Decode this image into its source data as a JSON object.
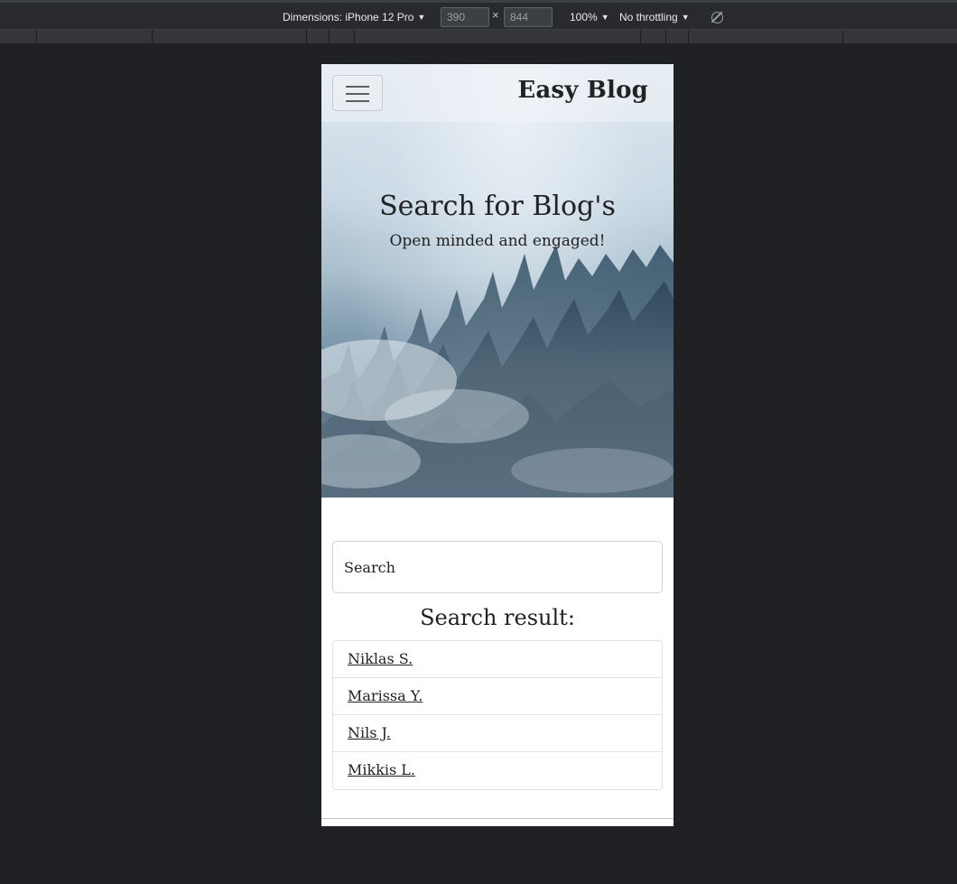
{
  "devtools": {
    "dimensions_label": "Dimensions: iPhone 12 Pro",
    "width_value": "390",
    "times": "×",
    "height_value": "844",
    "zoom": "100%",
    "throttling": "No throttling",
    "dropdown_arrow": "▼"
  },
  "navbar": {
    "brand": "Easy Blog",
    "toggler_icon": "hamburger-icon"
  },
  "hero": {
    "title": "Search for Blog's",
    "subtitle": "Open minded and engaged!"
  },
  "search": {
    "placeholder": "Search"
  },
  "results": {
    "title": "Search result:",
    "items": [
      {
        "label": "Niklas S."
      },
      {
        "label": "Marissa Y."
      },
      {
        "label": "Nils J."
      },
      {
        "label": "Mikkis L."
      }
    ]
  },
  "colors": {
    "devtools_bg": "#292a2d",
    "page_bg": "#202124",
    "text": "#222222"
  }
}
